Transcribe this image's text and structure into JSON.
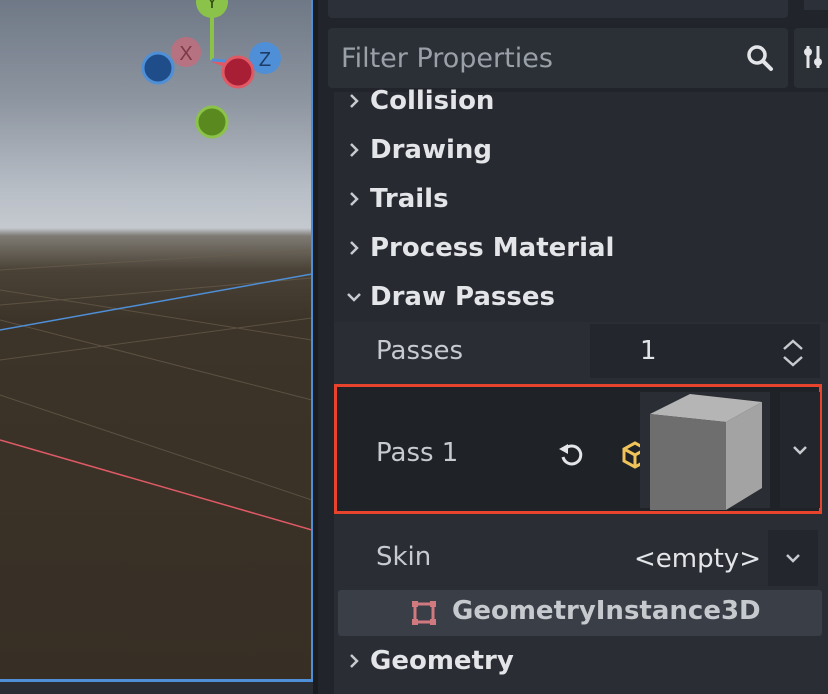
{
  "viewport": {
    "gizmo": {
      "x_label": "X",
      "y_label": "Y",
      "z_label": "Z"
    }
  },
  "inspector": {
    "filter": {
      "placeholder": "Filter Properties"
    },
    "sections": [
      {
        "label": "Collision",
        "expanded": false
      },
      {
        "label": "Drawing",
        "expanded": false
      },
      {
        "label": "Trails",
        "expanded": false
      },
      {
        "label": "Process Material",
        "expanded": false
      },
      {
        "label": "Draw Passes",
        "expanded": true
      }
    ],
    "draw_passes": {
      "passes_label": "Passes",
      "passes_value": "1",
      "pass1_label": "Pass 1",
      "skin_label": "Skin",
      "skin_value": "<empty>"
    },
    "category": {
      "label": "GeometryInstance3D"
    },
    "geometry_section": {
      "label": "Geometry",
      "expanded": false
    }
  },
  "colors": {
    "highlight": "#e8432c",
    "x_axis": "#e05a66",
    "y_axis": "#8bc34a",
    "z_axis": "#4f8fd7",
    "mesh_icon": "#f0c35a"
  }
}
